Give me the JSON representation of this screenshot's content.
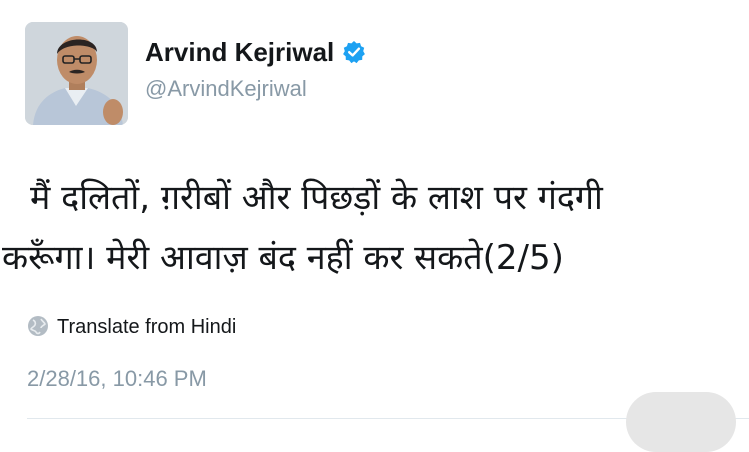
{
  "tweet": {
    "author_name": "Arvind Kejriwal",
    "author_handle": "@ArvindKejriwal",
    "verified": true,
    "text_line1": "मैं दलितों, ग़रीबों और पिछड़ों के लाश पर गंदगी",
    "text_line2": "करूँगा। मेरी आवाज़ बंद नहीं कर सकते(2/5)",
    "translate_label": "Translate from Hindi",
    "timestamp": "2/28/16, 10:46 PM"
  },
  "colors": {
    "text": "#14171a",
    "secondary": "#8899a6",
    "verified_blue": "#1da1f2",
    "divider": "#e1e8ed"
  },
  "icons": {
    "verified": "verified-badge-icon",
    "translate": "globe-icon"
  }
}
